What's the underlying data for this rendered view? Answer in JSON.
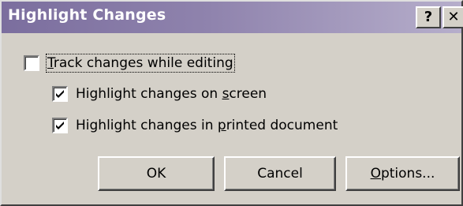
{
  "window": {
    "title": "Highlight Changes",
    "help_button": "?",
    "close_button": "✕"
  },
  "options": {
    "track_changes": {
      "label_access": "T",
      "label_rest": "rack changes while editing",
      "checked": false
    },
    "highlight_screen": {
      "label_before": "Highlight changes on ",
      "label_access": "s",
      "label_after": "creen",
      "checked": true
    },
    "highlight_print": {
      "label_before": "Highlight changes in ",
      "label_access": "p",
      "label_after": "rinted document",
      "checked": true
    }
  },
  "buttons": {
    "ok": "OK",
    "cancel": "Cancel",
    "options_access": "O",
    "options_rest": "ptions..."
  }
}
